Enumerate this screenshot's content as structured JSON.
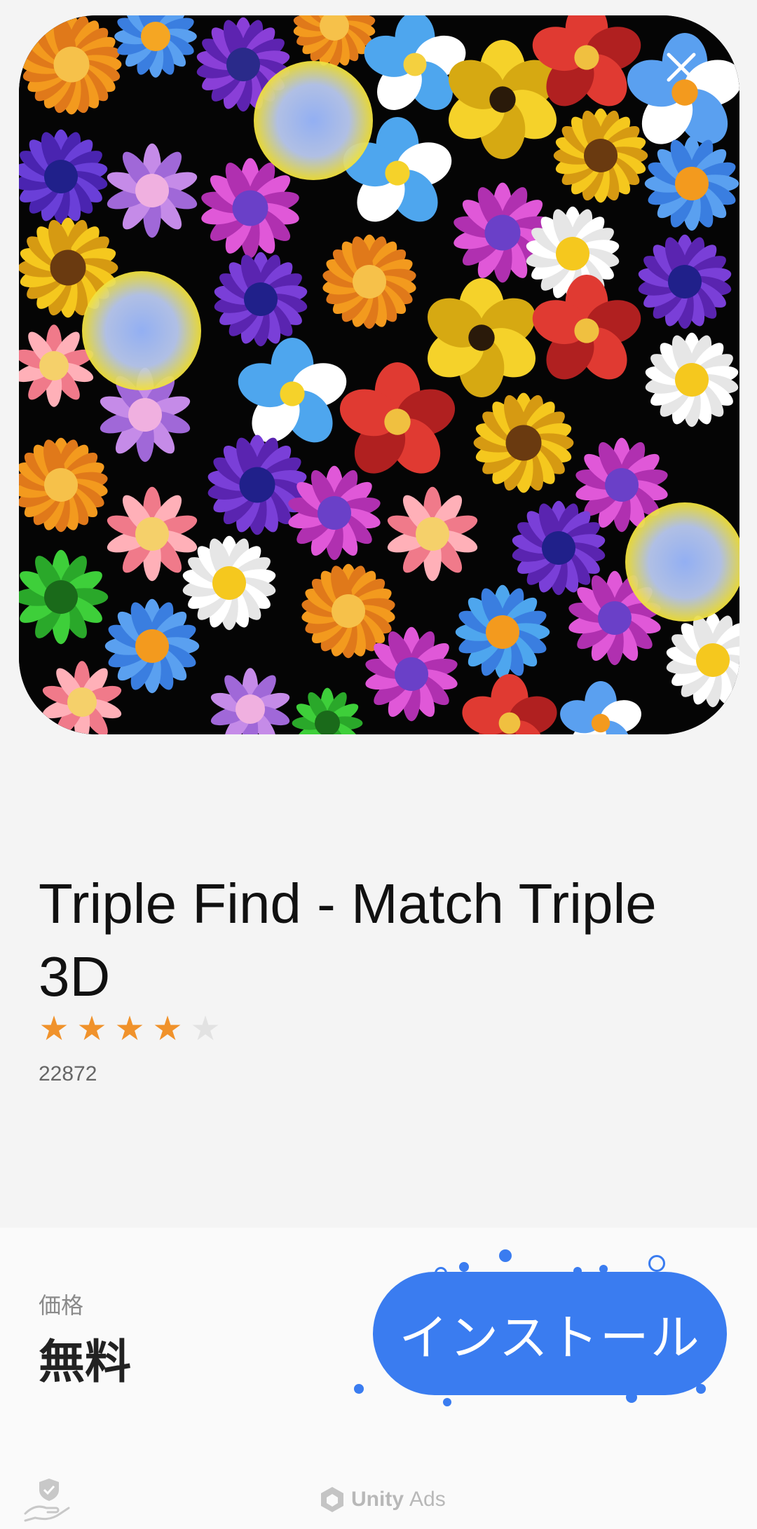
{
  "app": {
    "title": "Triple Find - Match Triple 3D",
    "rating": 4,
    "rating_max": 5,
    "review_count": "22872"
  },
  "price": {
    "label": "価格",
    "value": "無料"
  },
  "actions": {
    "install_label": "インストール",
    "close_icon": "close-icon"
  },
  "footer": {
    "brand_name": "Unity",
    "brand_suffix": "Ads",
    "privacy_icon": "privacy-hand-shield-icon"
  },
  "colors": {
    "accent": "#3a7cf0",
    "star_filled": "#f0922b",
    "star_empty": "#e2e2e2"
  }
}
